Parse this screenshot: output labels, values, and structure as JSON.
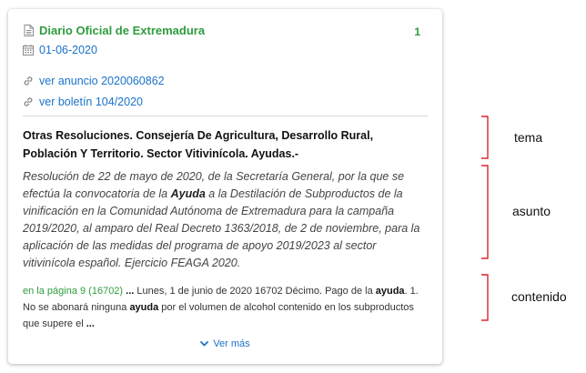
{
  "card": {
    "source": {
      "icon": "document-icon",
      "label": "Diario Oficial de Extremadura"
    },
    "count": "1",
    "date": {
      "icon": "calendar-icon",
      "value": "01-06-2020"
    },
    "links": [
      {
        "icon": "link-icon",
        "label": "ver anuncio 2020060862"
      },
      {
        "icon": "link-icon",
        "label": "ver boletín 104/2020"
      }
    ],
    "tema": "Otras Resoluciones. Consejería De Agricultura, Desarrollo Rural, Población Y Territorio. Sector Vitivinícola. Ayudas.-",
    "asunto": {
      "part1": "Resolución de 22 de mayo de 2020, de la Secretaría General, por la que se efectúa la convocatoria de la ",
      "highlight": "Ayuda",
      "part2": " a la Destilación de Subproductos de la vinificación en la Comunidad Autónoma de Extremadura para la campaña 2019/2020, al amparo del Real Decreto 1363/2018, de 2 de noviembre, para la aplicación de las medidas del programa de apoyo 2019/2023 al sector vitivinícola español. Ejercicio FEAGA 2020."
    },
    "contenido": {
      "page_link": "en la página 9 (16702)",
      "ellipsis1": " ... ",
      "text1": "Lunes, 1 de junio de 2020 16702 Décimo. Pago de la ",
      "highlight1": "ayuda",
      "text2": ". 1. No se abonará ninguna ",
      "highlight2": "ayuda",
      "text3": " por el volumen de alcohol contenido en los subproductos que supere el ",
      "ellipsis2": "..."
    },
    "ver_mas": {
      "icon": "chevron-down-icon",
      "label": "Ver más"
    }
  },
  "annotations": {
    "tema": "tema",
    "asunto": "asunto",
    "contenido": "contenido"
  },
  "colors": {
    "green": "#2e9c3e",
    "blue": "#1a73c8",
    "brace_red": "#d9262e"
  }
}
